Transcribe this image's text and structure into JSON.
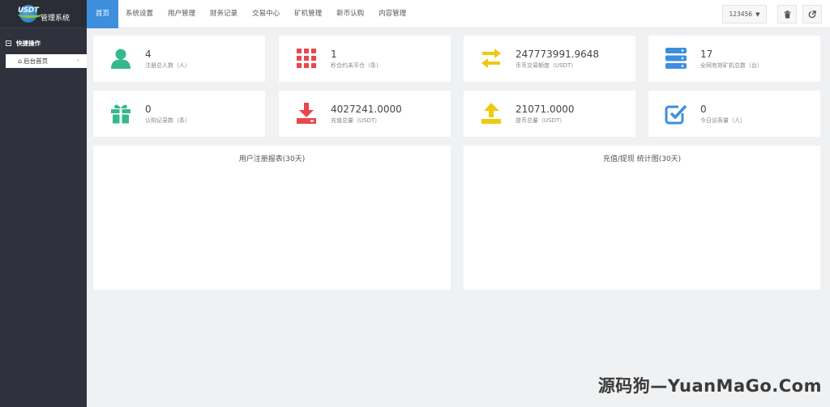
{
  "logo": {
    "mark_text": "USDT",
    "title": "管理系统"
  },
  "sidebar": {
    "section_label": "快捷操作",
    "items": [
      {
        "label": "后台首页"
      }
    ]
  },
  "nav": {
    "items": [
      {
        "label": "首页",
        "active": true
      },
      {
        "label": "系统设置"
      },
      {
        "label": "用户管理"
      },
      {
        "label": "财务记录"
      },
      {
        "label": "交易中心"
      },
      {
        "label": "矿机管理"
      },
      {
        "label": "新币认购"
      },
      {
        "label": "内容管理"
      }
    ]
  },
  "header": {
    "user": "123456"
  },
  "stats": [
    {
      "value": "4",
      "label": "注册总人数（人）",
      "icon": "user-icon",
      "color": "#35b98b"
    },
    {
      "value": "1",
      "label": "秒合约未平仓（条）",
      "icon": "grid-icon",
      "color": "#e8474b"
    },
    {
      "value": "247773991.9648",
      "label": "币币交易额度（USDT）",
      "icon": "exchange-icon",
      "color": "#f2c80f"
    },
    {
      "value": "17",
      "label": "全网有效矿机总数（台）",
      "icon": "server-icon",
      "color": "#3e8ede"
    },
    {
      "value": "0",
      "label": "认购记录数（条）",
      "icon": "gift-icon",
      "color": "#35b98b"
    },
    {
      "value": "4027241.0000",
      "label": "充值总量（USDT）",
      "icon": "download-icon",
      "color": "#e8474b"
    },
    {
      "value": "21071.0000",
      "label": "提币总量（USDT）",
      "icon": "upload-icon",
      "color": "#f2c80f"
    },
    {
      "value": "0",
      "label": "今日访客量（人）",
      "icon": "checkbox-icon",
      "color": "#3e8ede"
    }
  ],
  "panels": [
    {
      "title": "用户注册报表(30天)"
    },
    {
      "title": "充值/提现 统计图(30天)"
    }
  ],
  "watermark": "源码狗—YuanMaGo.Com"
}
